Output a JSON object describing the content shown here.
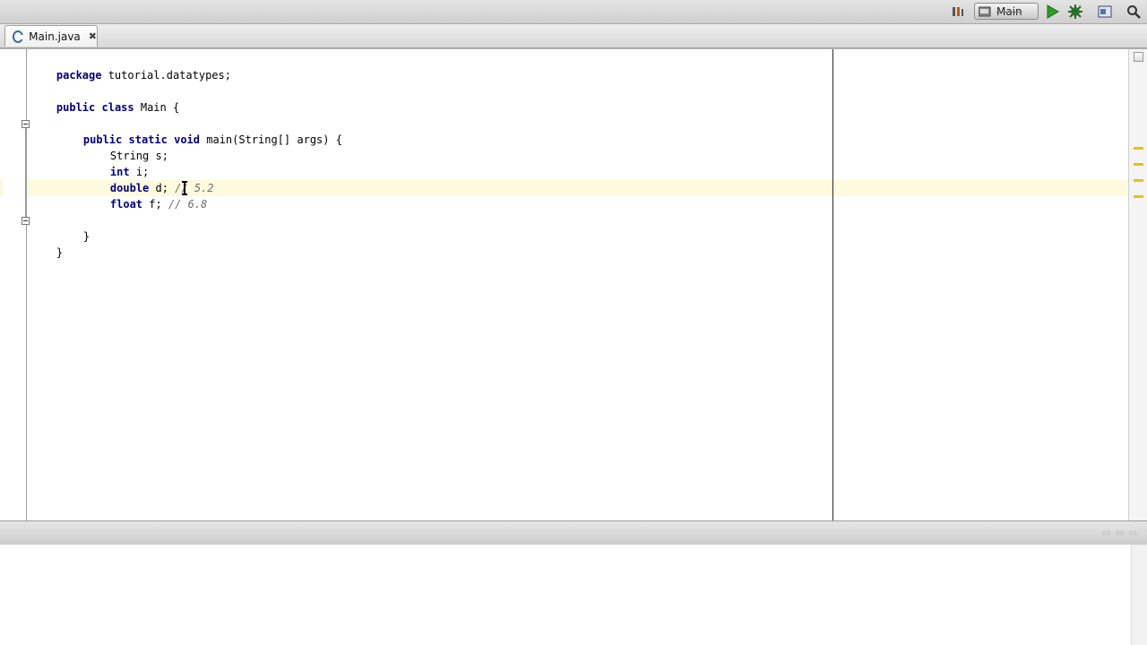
{
  "toolbar": {
    "run_config": "Main",
    "icons": [
      "profile-icon",
      "run-config-icon",
      "run-icon",
      "debug-icon",
      "build-icon",
      "search-icon"
    ]
  },
  "tabs": [
    {
      "label": "Main.java",
      "close": "✖"
    }
  ],
  "code": {
    "line1": {
      "kw": "package",
      "rest": " tutorial.datatypes;"
    },
    "line3": {
      "kw1": "public",
      "kw2": "class",
      "rest": " Main {"
    },
    "line5": {
      "kw1": "public",
      "kw2": "static",
      "kw3": "void",
      "rest": " main(String[] args) {"
    },
    "line6": {
      "type": "String",
      "var": " s;"
    },
    "line7": {
      "kw": "int",
      "var": " i;"
    },
    "line8": {
      "kw": "double",
      "var": " d; ",
      "comment": "// 5.2"
    },
    "line9": {
      "kw": "float",
      "var": " f; ",
      "comment": "// 6.8"
    },
    "line11": {
      "text": "}"
    },
    "line12": {
      "text": "}"
    }
  },
  "colors": {
    "keyword": "#000080",
    "comment": "#6e6e6e",
    "current_line": "#fdfadd",
    "warning_mark": "#e8c400"
  }
}
